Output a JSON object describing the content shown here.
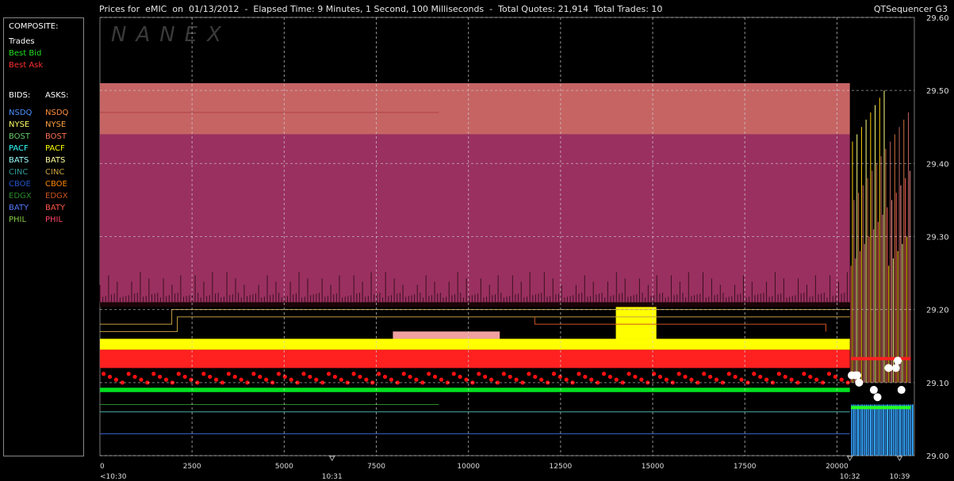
{
  "header": {
    "title": "Prices for  eMIC  on  01/13/2012  -  Elapsed Time: 9 Minutes, 1 Second, 100 Milliseconds  -  Total Quotes: 21,914  Total Trades: 10",
    "app_name": "QTSequencer G3"
  },
  "watermark": "NANEX",
  "legend": {
    "composite_heading": "COMPOSITE:",
    "composite": [
      {
        "label": "Trades",
        "color": "#ffffff"
      },
      {
        "label": "Best Bid",
        "color": "#22e022"
      },
      {
        "label": "Best Ask",
        "color": "#ff3030"
      }
    ],
    "bids_heading": "BIDS:",
    "asks_heading": "ASKS:",
    "exchanges": [
      {
        "bid": "NSDQ",
        "ask": "NSDQ",
        "bid_color": "#4a90ff",
        "ask_color": "#ff8c3a"
      },
      {
        "bid": "NYSE",
        "ask": "NYSE",
        "bid_color": "#ffff66",
        "ask_color": "#ffa040"
      },
      {
        "bid": "BOST",
        "ask": "BOST",
        "bid_color": "#66cc66",
        "ask_color": "#ff7050"
      },
      {
        "bid": "PACF",
        "ask": "PACF",
        "bid_color": "#33ffff",
        "ask_color": "#ffff00"
      },
      {
        "bid": "BATS",
        "ask": "BATS",
        "bid_color": "#99ffff",
        "ask_color": "#ffff99"
      },
      {
        "bid": "CINC",
        "ask": "CINC",
        "bid_color": "#339999",
        "ask_color": "#c8a040"
      },
      {
        "bid": "CBOE",
        "ask": "CBOE",
        "bid_color": "#2255cc",
        "ask_color": "#ff8800"
      },
      {
        "bid": "EDGX",
        "ask": "EDGX",
        "bid_color": "#2a8a2a",
        "ask_color": "#cc5520"
      },
      {
        "bid": "BATY",
        "ask": "BATY",
        "bid_color": "#5577ff",
        "ask_color": "#ff5544"
      },
      {
        "bid": "PHIL",
        "ask": "PHIL",
        "bid_color": "#88cc44",
        "ask_color": "#ff4466"
      }
    ]
  },
  "chart_data": {
    "type": "line",
    "x_axis": {
      "min": 0,
      "max": 22100,
      "ticks": [
        0,
        2500,
        5000,
        7500,
        10000,
        12500,
        15000,
        17500,
        20000
      ],
      "tick_labels": [
        "0",
        "2500",
        "5000",
        "7500",
        "10000",
        "12500",
        "15000",
        "17500",
        "20000"
      ],
      "time_labels": [
        {
          "x": 0,
          "label": "<10:30"
        },
        {
          "x": 6300,
          "label": "10:31"
        },
        {
          "x": 20350,
          "label": "10:32"
        },
        {
          "x": 21700,
          "label": "10:39"
        }
      ]
    },
    "y_axis": {
      "min": 29.0,
      "max": 29.6,
      "ticks": [
        29.0,
        29.1,
        29.2,
        29.3,
        29.4,
        29.5,
        29.6
      ],
      "tick_labels": [
        "29.00",
        "29.10",
        "29.20",
        "29.30",
        "29.40",
        "29.50",
        "29.60"
      ]
    },
    "bands": [
      {
        "name": "upper-ask-band",
        "x0": 0,
        "x1": 20350,
        "y0": 29.44,
        "y1": 29.51,
        "color": "#c66464"
      },
      {
        "name": "lower-ask-band",
        "x0": 0,
        "x1": 20350,
        "y0": 29.21,
        "y1": 29.44,
        "color": "#9a3060"
      },
      {
        "name": "yellow-ask-band",
        "x0": 0,
        "x1": 20350,
        "y0": 29.145,
        "y1": 29.16,
        "color": "#ffff00"
      },
      {
        "name": "red-ask-band",
        "x0": 0,
        "x1": 20350,
        "y0": 29.12,
        "y1": 29.145,
        "color": "#ff2020"
      },
      {
        "name": "green-bid-band",
        "x0": 0,
        "x1": 20350,
        "y0": 29.087,
        "y1": 29.093,
        "color": "#00e020"
      },
      {
        "name": "pink-block",
        "x0": 7950,
        "x1": 10850,
        "y0": 29.16,
        "y1": 29.17,
        "color": "#f0a0a0"
      },
      {
        "name": "yellow-spike-block",
        "x0": 14000,
        "x1": 15100,
        "y0": 29.16,
        "y1": 29.21,
        "color": "#ffff00"
      }
    ],
    "lines": [
      {
        "name": "nsdq-bid",
        "color": "#3a66cc",
        "points": [
          [
            0,
            29.03
          ],
          [
            20350,
            29.03
          ]
        ]
      },
      {
        "name": "bats-bid",
        "color": "#4ab0b0",
        "points": [
          [
            0,
            29.06
          ],
          [
            20350,
            29.06
          ]
        ]
      },
      {
        "name": "edgx-bid",
        "color": "#2a8a2a",
        "points": [
          [
            0,
            29.07
          ],
          [
            9200,
            29.07
          ]
        ]
      },
      {
        "name": "ask-step-1",
        "color": "#c8a040",
        "points": [
          [
            0,
            29.18
          ],
          [
            1950,
            29.18
          ],
          [
            1950,
            29.2
          ],
          [
            20350,
            29.2
          ]
        ]
      },
      {
        "name": "ask-step-2",
        "color": "#c8a040",
        "points": [
          [
            0,
            29.17
          ],
          [
            2100,
            29.17
          ],
          [
            2100,
            29.19
          ],
          [
            20350,
            29.19
          ]
        ]
      },
      {
        "name": "ask-step-3",
        "color": "#cc5520",
        "points": [
          [
            11800,
            29.19
          ],
          [
            11800,
            29.18
          ],
          [
            19700,
            29.18
          ],
          [
            19700,
            29.17
          ]
        ]
      },
      {
        "name": "phil-ask",
        "color": "#b04040",
        "points": [
          [
            0,
            29.47
          ],
          [
            9200,
            29.47
          ]
        ]
      }
    ],
    "series": [
      {
        "name": "Trades",
        "color": "#ffffff",
        "x": [
          20400,
          20500,
          20600,
          21000,
          21400,
          21600,
          21650,
          21750,
          20550,
          21100
        ],
        "y": [
          29.11,
          29.11,
          29.1,
          29.09,
          29.12,
          29.12,
          29.13,
          29.09,
          29.11,
          29.08
        ]
      }
    ]
  }
}
